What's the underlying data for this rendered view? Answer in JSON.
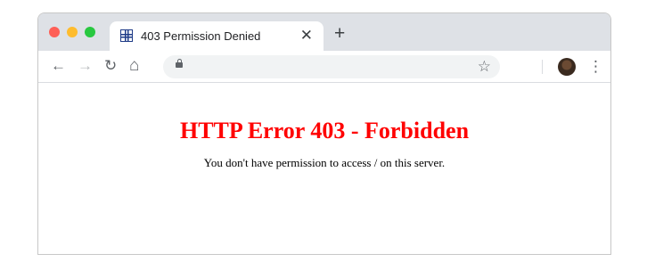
{
  "browser": {
    "tab": {
      "title": "403 Permission Denied",
      "favicon": "grid-favicon-icon",
      "close_glyph": "✕"
    },
    "new_tab_glyph": "+",
    "toolbar": {
      "back_glyph": "←",
      "forward_glyph": "→",
      "reload_glyph": "↻",
      "home_glyph": "⌂",
      "address": "",
      "bookmark_glyph": "☆",
      "menu_glyph": "⋮"
    },
    "colors": {
      "traffic_red": "#fe5f57",
      "traffic_yellow": "#febc2e",
      "traffic_green": "#28c840",
      "tabstrip": "#dee1e6"
    }
  },
  "page": {
    "title": "HTTP Error 403 - Forbidden",
    "message": "You don't have permission to access / on this server.",
    "title_color": "#ff0000"
  }
}
